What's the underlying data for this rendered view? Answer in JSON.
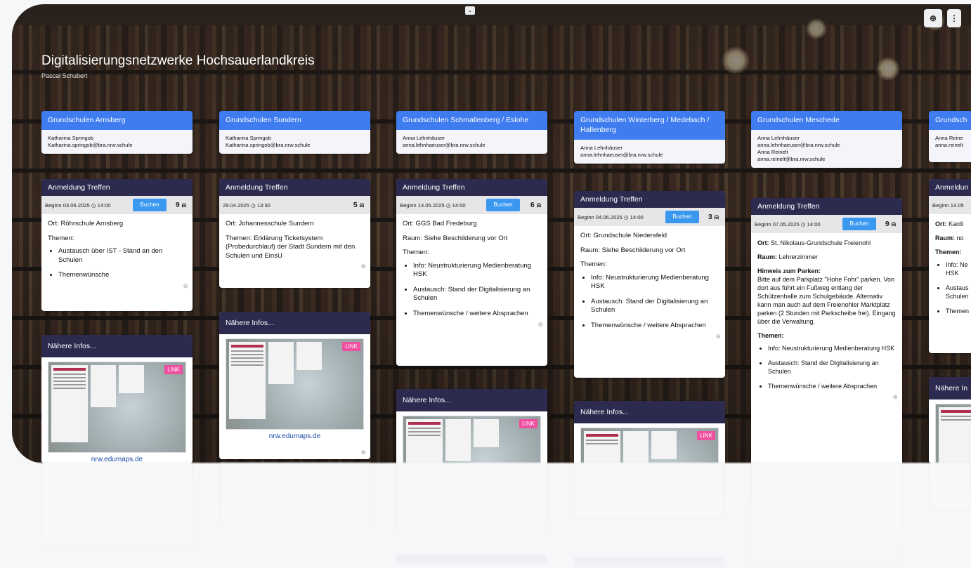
{
  "header": {
    "title": "Digitalisierungsnetzwerke Hochsauerlandkreis",
    "subtitle": "Pascal Schubert"
  },
  "toolbar": {
    "chevron": "⌄",
    "zoom_icon": "search-plus-icon",
    "more_icon": "more-icon"
  },
  "columns": [
    {
      "title": "Grundschulen Arnsberg",
      "contact": [
        "Katharina Springob",
        "Katharina.springob@bra.nrw.schule"
      ]
    },
    {
      "title": "Grundschulen Sundern",
      "contact": [
        "Katharina Springob",
        "Katharina.springob@bra.nrw.schule"
      ]
    },
    {
      "title": "Grundschulen Schmallenberg / Eslohe",
      "contact": [
        "Anna Lehnhäuser",
        "anna.lehnhaeuser@bra.nrw.schule"
      ]
    },
    {
      "title": "Grundschulen Winterberg / Medebach / Hallenberg",
      "contact": [
        "Anna Lehnhäuser",
        "anna.lehnhaeuser@bra.nrw.schule"
      ]
    },
    {
      "title": "Grundschulen Meschede",
      "contact": [
        "Anna Lehnhäuser",
        "anna.lehnhaeuser@bra.nrw.schule",
        "Anna Reinelt",
        "anna.reinelt@bra.nrw.schule"
      ]
    },
    {
      "title": "Grundsch",
      "contact": [
        "Anna Reine",
        "anna.reinelt"
      ]
    }
  ],
  "cards": [
    {
      "title": "Anmeldung Treffen",
      "date": "Beginn 03.06.2025",
      "time": "14:00",
      "button": "Buchen",
      "count": "9",
      "lines": [
        "Ort: Röhrschule Arnsberg",
        "Themen:"
      ],
      "items": [
        "Austausch über IST - Stand an den Schulen",
        "Themenwünsche"
      ]
    },
    {
      "title": "Anmeldung Treffen",
      "date": "29.04.2025",
      "time": "13:30",
      "button": "",
      "count": "5",
      "lines": [
        "Ort: Johannesschule Sundern",
        "Themen: Erklärung Ticketsystem (Probedurchlauf) der Stadt Sundern mit den Schulen und EinsU"
      ],
      "items": []
    },
    {
      "title": "Anmeldung Treffen",
      "date": "Beginn 14.05.2025",
      "time": "14:00",
      "button": "Buchen",
      "count": "6",
      "lines": [
        "Ort: GGS Bad Fredeburg",
        "Raum: Siehe Beschilderung vor Ort",
        "Themen:"
      ],
      "items": [
        "Info: Neustrukturierung Medienberatung HSK",
        "Austausch: Stand der Digitalisierung an Schulen",
        "Themenwünsche / weitere Absprachen"
      ]
    },
    {
      "title": "Anmeldung Treffen",
      "date": "Beginn 04.06.2025",
      "time": "14:00",
      "button": "Buchen",
      "count": "3",
      "lines": [
        "Ort: Grundschule Niedersfeld",
        "Raum: Siehe Beschilderung vor Ort",
        "Themen:"
      ],
      "items": [
        "Info: Neustrukturierung Medienberatung HSK",
        "Austausch: Stand der Digitalisierung an Schulen",
        "Themenwünsche / weitere Absprachen"
      ]
    },
    {
      "title": "Anmeldung Treffen",
      "date": "Beginn 07.05.2025",
      "time": "14:00",
      "button": "Buchen",
      "count": "9",
      "ort_label": "Ort:",
      "ort": "St. Nikolaus-Grundschule Freienohl",
      "raum_label": "Raum:",
      "raum": "Lehrerzimmer",
      "park_label": "Hinweis zum Parken:",
      "park": "Bitte auf dem Parkplatz \"Hohe Fohr\" parken. Von dort aus führt ein Fußweg entlang der Schützenhalle zum Schulgebäude. Alternativ kann man auch auf dem Freienohler Marktplatz parken (2 Stunden mit Parkscheibe frei). Eingang über die Verwaltung.",
      "themen_label": "Themen:",
      "items": [
        "Info: Neustrukturierung Medienberatung HSK",
        "Austausch: Stand der Digitalisierung an Schulen",
        "Themenwünsche / weitere Absprachen"
      ]
    },
    {
      "title": "Anmeldun",
      "date": "Beginn 14.05",
      "ort_label": "Ort:",
      "ort": "Kardi",
      "raum_label": "Raum:",
      "raum": "no",
      "themen_label": "Themen:",
      "items": [
        "Info: Ne HSK",
        "Austaus Schulen",
        "Themen"
      ]
    }
  ],
  "infos": {
    "title": "Nähere Infos...",
    "link": "LINK",
    "url": "nrw.edumaps.de"
  },
  "partial_info_title": "Nähere In"
}
